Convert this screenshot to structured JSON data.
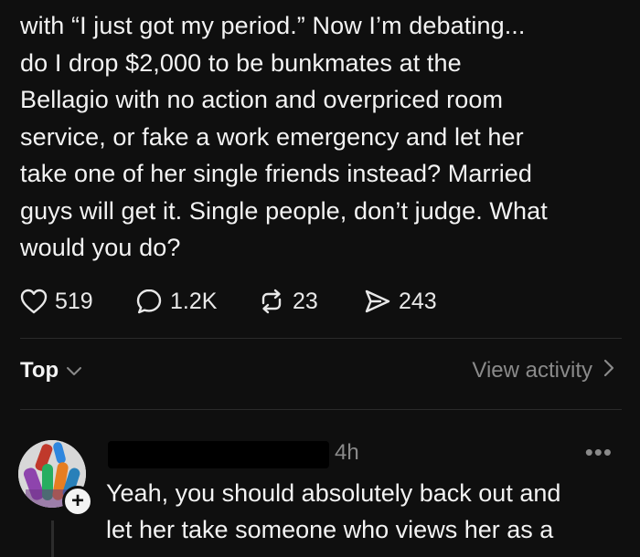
{
  "post": {
    "body_lines": [
      "with “I just got my period.” Now I’m debating...",
      "do I drop $2,000 to be bunkmates at the",
      "Bellagio with no action and overpriced room",
      "service, or fake a work emergency and let her",
      "take one of her single friends instead? Married",
      "guys will get it. Single people, don’t judge. What",
      "would you do?"
    ],
    "actions": {
      "likes": "519",
      "replies": "1.2K",
      "reposts": "23",
      "shares": "243"
    }
  },
  "sort": {
    "label": "Top",
    "view_activity_label": "View activity"
  },
  "reply": {
    "timestamp": "4h",
    "more_label": "•••",
    "follow_label": "+",
    "text_lines": [
      "Yeah, you should absolutely back out and",
      "let her take someone who views her as a"
    ]
  },
  "colors": {
    "background": "#0f0f0f",
    "text": "#f3f3f3",
    "muted": "#8a8a8a",
    "divider": "#2a2a2a"
  },
  "icons": {
    "like": "heart-icon",
    "reply": "speech-bubble-icon",
    "repost": "repost-arrows-icon",
    "share": "paper-plane-icon",
    "sort": "chevron-down-icon",
    "view_activity": "chevron-right-icon",
    "more": "more-dots-icon"
  }
}
